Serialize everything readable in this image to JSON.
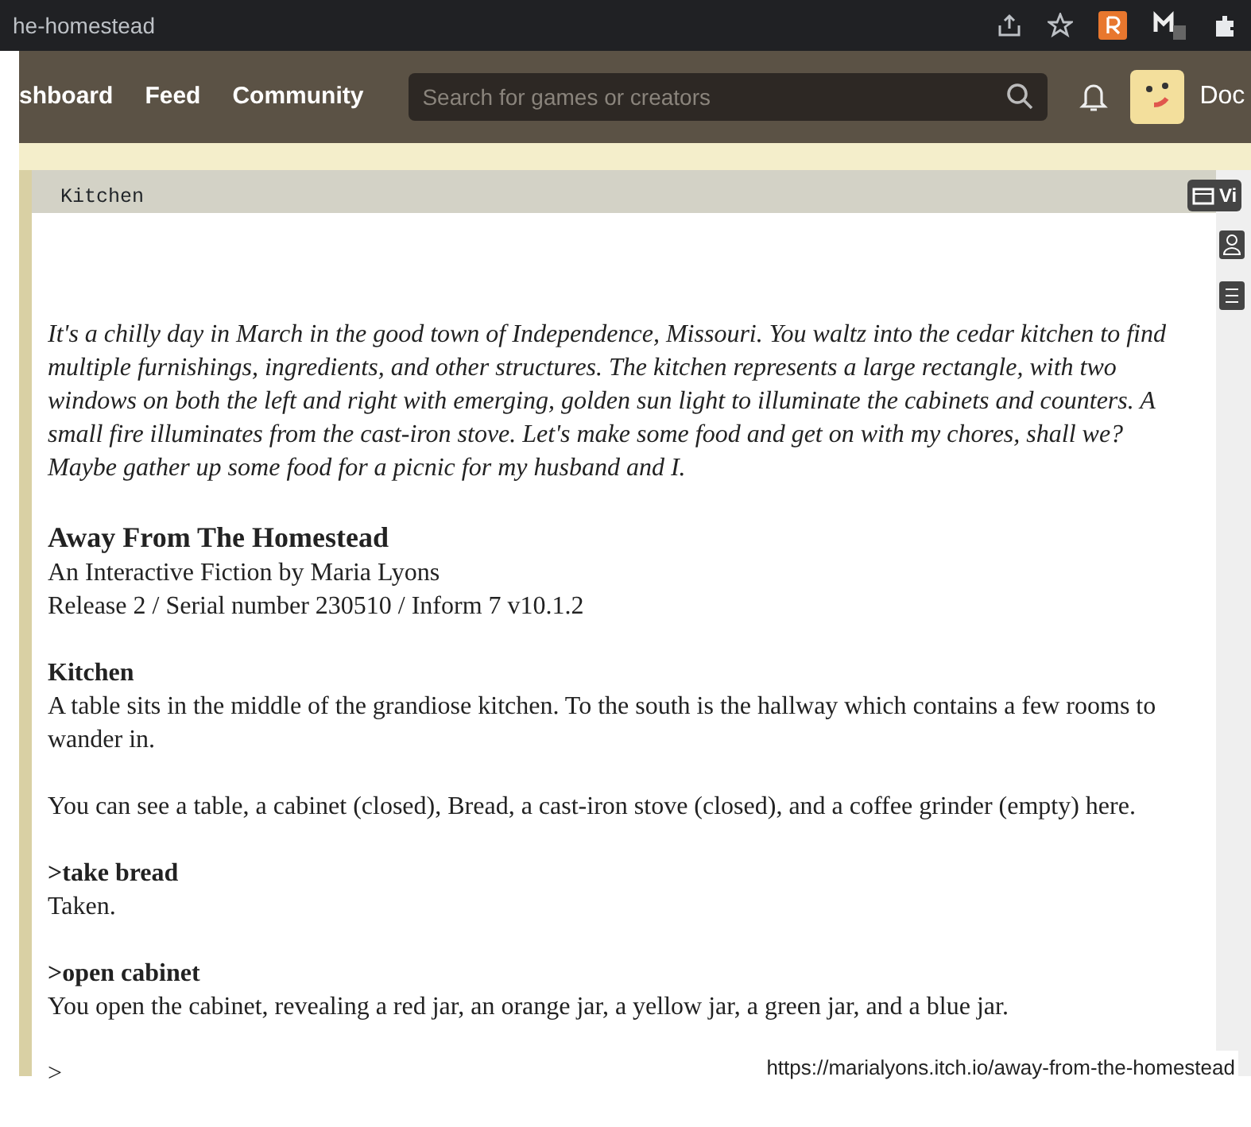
{
  "browser": {
    "url": "he-homestead"
  },
  "nav": {
    "links": [
      {
        "label": "shboard"
      },
      {
        "label": "Feed"
      },
      {
        "label": "Community"
      }
    ],
    "search": {
      "placeholder": "Search for games or creators"
    },
    "user": "Doc"
  },
  "side_button": {
    "label": "Vi"
  },
  "status_line": "Kitchen",
  "transcript": [
    {
      "kind": "intro",
      "text": "It's a chilly day in March in the good town of Independence, Missouri. You waltz into the cedar kitchen to find multiple furnishings, ingredients, and other structures. The kitchen represents a large rectangle, with two windows on both the left and right with emerging, golden sun light to illuminate the cabinets and counters. A small fire illuminates from the cast-iron stove. Let's make some food and get on with my chores, shall we? Maybe gather up some food for a picnic for my husband and I."
    },
    {
      "kind": "title",
      "text": "Away From The Homestead"
    },
    {
      "kind": "line",
      "text": "An Interactive Fiction by Maria Lyons"
    },
    {
      "kind": "line",
      "text": "Release 2 / Serial number 230510 / Inform 7 v10.1.2"
    },
    {
      "kind": "room",
      "text": "Kitchen"
    },
    {
      "kind": "line",
      "text": "A table sits in the middle of the grandiose kitchen. To the south is the hallway which contains a few rooms to wander in."
    },
    {
      "kind": "para",
      "text": "You can see a table, a cabinet (closed), Bread, a cast-iron stove (closed), and a coffee grinder (empty) here."
    },
    {
      "kind": "command",
      "text": ">take bread"
    },
    {
      "kind": "line",
      "text": "Taken."
    },
    {
      "kind": "command",
      "text": ">open cabinet"
    },
    {
      "kind": "line",
      "text": "You open the cabinet, revealing a red jar, an orange jar, a yellow jar, a green jar, and a blue jar."
    },
    {
      "kind": "prompt",
      "text": ">"
    }
  ],
  "caption": "https://marialyons.itch.io/away-from-the-homestead"
}
